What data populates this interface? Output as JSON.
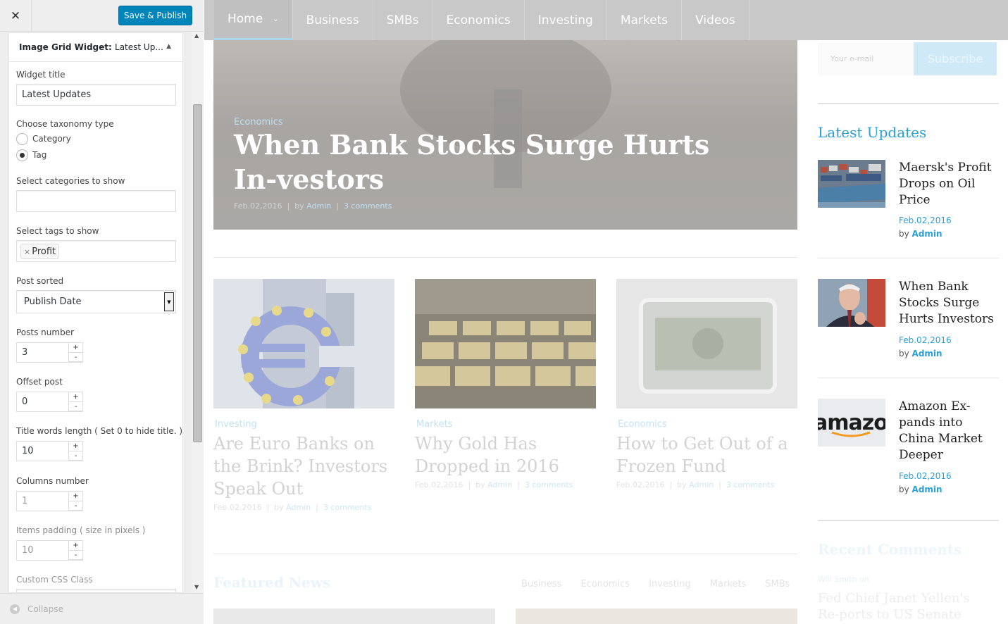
{
  "customizer": {
    "close_icon": "close-icon",
    "publish_label": "Save & Publish",
    "widget_header": {
      "title_prefix": "Image Grid Widget:",
      "title_suffix": "Latest Up..."
    },
    "fields": {
      "widget_title_label": "Widget title",
      "widget_title_value": "Latest Updates",
      "taxonomy_label": "Choose taxonomy type",
      "taxonomy_options": [
        "Category",
        "Tag"
      ],
      "taxonomy_selected": "Tag",
      "categories_label": "Select categories to show",
      "categories_value": "",
      "tags_label": "Select tags to show",
      "tags": [
        "Profit"
      ],
      "sorted_label": "Post sorted",
      "sorted_value": "Publish Date",
      "posts_number_label": "Posts number",
      "posts_number": "3",
      "offset_label": "Offset post",
      "offset": "0",
      "title_words_label": "Title words length ( Set 0 to hide title. )",
      "title_words": "10",
      "columns_label": "Columns number",
      "columns": "1",
      "padding_label": "Items padding ( size in pixels )",
      "padding": "10",
      "css_label": "Custom CSS Class"
    },
    "collapse_label": "Collapse"
  },
  "preview": {
    "nav": [
      "Home",
      "Business",
      "SMBs",
      "Economics",
      "Investing",
      "Markets",
      "Videos"
    ],
    "hero": {
      "category": "Economics",
      "title": "When Bank Stocks Surge Hurts In-vestors",
      "date": "Feb.02,2016",
      "by": "by",
      "author": "Admin",
      "comments": "3 comments"
    },
    "cards": [
      {
        "category": "Investing",
        "title": "Are Euro Banks on the Brink? Investors Speak Out",
        "date": "Feb.02,2016",
        "by": "by",
        "author": "Admin",
        "comments": "3 comments"
      },
      {
        "category": "Markets",
        "title": "Why Gold Has Dropped in 2016",
        "date": "Feb.02,2016",
        "by": "by",
        "author": "Admin",
        "comments": "3 comments"
      },
      {
        "category": "Economics",
        "title": "How to Get Out of a Frozen Fund",
        "date": "Feb.02,2016",
        "by": "by",
        "author": "Admin",
        "comments": "3 comments"
      }
    ],
    "featured": {
      "title": "Featured News",
      "tabs": [
        "Business",
        "Economics",
        "Investing",
        "Markets",
        "SMBs"
      ]
    },
    "newsletter": {
      "placeholder": "Your e-mail",
      "button": "Subscribe"
    },
    "latest": {
      "title": "Latest Updates",
      "items": [
        {
          "title": "Maersk's Profit Drops on Oil Price",
          "date": "Feb.02,2016",
          "by": "by",
          "author": "Admin"
        },
        {
          "title": "When Bank Stocks Surge Hurts Investors",
          "date": "Feb.02,2016",
          "by": "by",
          "author": "Admin"
        },
        {
          "title": "Amazon Ex-pands into China Market Deeper",
          "date": "Feb.02,2016",
          "by": "by",
          "author": "Admin"
        }
      ]
    },
    "recent_comments": {
      "title": "Recent Comments",
      "author": "Will Smith on",
      "post": "Fed Chief Janet Yellen's Re-ports to US Senate"
    },
    "amazon_logo_text": "amazo"
  },
  "colors": {
    "accent": "#2aa0d6",
    "publish": "#0085ba",
    "nav": "#c8c8c8"
  }
}
